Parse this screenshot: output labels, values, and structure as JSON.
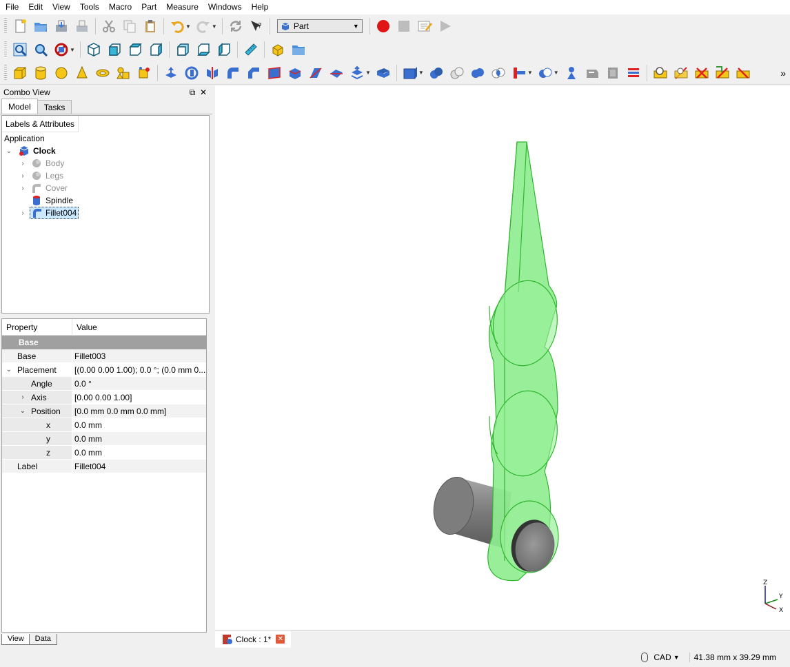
{
  "menu": [
    "File",
    "Edit",
    "View",
    "Tools",
    "Macro",
    "Part",
    "Measure",
    "Windows",
    "Help"
  ],
  "toolbar": {
    "workbench_label": "Part",
    "row1_icons": [
      "new-document-icon",
      "open-icon",
      "save-icon",
      "save-as-icon",
      "cut-icon",
      "copy-icon",
      "paste-icon",
      "undo-icon",
      "redo-icon",
      "refresh-icon",
      "whats-this-icon"
    ],
    "macro_icons": [
      "record-macro-icon",
      "stop-macro-icon",
      "edit-macro-icon",
      "run-macro-icon"
    ],
    "view_icons": [
      "fit-all-icon",
      "fit-selection-icon",
      "draw-style-icon",
      "isometric-view-icon",
      "front-view-icon",
      "top-view-icon",
      "right-view-icon",
      "rear-view-icon",
      "bottom-view-icon",
      "left-view-icon",
      "measure-distance-icon",
      "create-part-icon",
      "create-group-icon"
    ],
    "part_icons": [
      "box-icon",
      "cylinder-icon",
      "sphere-icon",
      "cone-icon",
      "torus-icon",
      "primitives-icon",
      "shape-builder-icon",
      "extrude-icon",
      "revolve-icon",
      "mirror-icon",
      "fillet-icon",
      "chamfer-icon",
      "make-face-icon",
      "ruled-surface-icon",
      "loft-icon",
      "sweep-icon",
      "section-icon",
      "cross-sections-icon",
      "compound-icon",
      "boolean-icon",
      "cut-icon",
      "fuse-icon",
      "common-icon",
      "join-icon",
      "split-icon",
      "check-geometry-icon",
      "defeaturing-icon",
      "projection-icon",
      "offset-icon",
      "thickness-icon",
      "measure-linear-icon",
      "measure-angular-icon",
      "measure-clear-icon",
      "measure-toggle-all-icon",
      "measure-toggle-3d-icon",
      "measure-toggle-delta-icon"
    ],
    "overflow": "»"
  },
  "combo": {
    "title": "Combo View",
    "tab_model": "Model",
    "tab_tasks": "Tasks",
    "tree_header": "Labels & Attributes",
    "application": "Application",
    "tree": [
      {
        "label": "Clock",
        "bold": true,
        "expand": "⌄",
        "depth": 0
      },
      {
        "label": "Body",
        "grey": true,
        "expand": "›",
        "depth": 1
      },
      {
        "label": "Legs",
        "grey": true,
        "expand": "›",
        "depth": 1
      },
      {
        "label": "Cover",
        "grey": true,
        "expand": "›",
        "depth": 1
      },
      {
        "label": "Spindle",
        "expand": "",
        "depth": 1
      },
      {
        "label": "Fillet004",
        "selected": true,
        "expand": "›",
        "depth": 1
      }
    ],
    "prop_header_property": "Property",
    "prop_header_value": "Value",
    "group": "Base",
    "properties": [
      {
        "name": "Base",
        "value": "Fillet003",
        "indent": 0,
        "expand": ""
      },
      {
        "name": "Placement",
        "value": "[(0.00 0.00 1.00); 0.0 °; (0.0 mm  0....",
        "indent": 0,
        "expand": "⌄"
      },
      {
        "name": "Angle",
        "value": "0.0 °",
        "indent": 1,
        "expand": ""
      },
      {
        "name": "Axis",
        "value": "[0.00 0.00 1.00]",
        "indent": 1,
        "expand": "›"
      },
      {
        "name": "Position",
        "value": "[0.0 mm  0.0 mm  0.0 mm]",
        "indent": 1,
        "expand": "⌄"
      },
      {
        "name": "x",
        "value": "0.0 mm",
        "indent": 2,
        "expand": ""
      },
      {
        "name": "y",
        "value": "0.0 mm",
        "indent": 2,
        "expand": ""
      },
      {
        "name": "z",
        "value": "0.0 mm",
        "indent": 2,
        "expand": ""
      },
      {
        "name": "Label",
        "value": "Fillet004",
        "indent": 0,
        "expand": ""
      }
    ],
    "bottom_tab_view": "View",
    "bottom_tab_data": "Data"
  },
  "document_tab": "Clock : 1*",
  "axis_labels": {
    "z": "Z",
    "y": "Y",
    "x": "X"
  },
  "status": {
    "nav_style": "CAD",
    "dimensions": "41.38 mm x 39.29 mm"
  },
  "colors": {
    "selection_green": "#90ee90",
    "edge_green": "#2fb52f",
    "spindle_grey": "#8a8a8a"
  }
}
